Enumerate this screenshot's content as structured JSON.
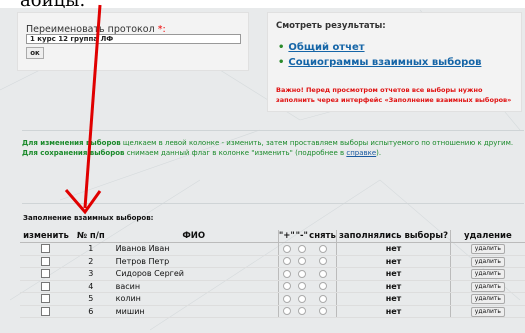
{
  "top_text": "абицы.",
  "rename": {
    "label": "Переименовать протокол",
    "required_mark": " *:",
    "value": "1 курс 12 группа ЛФ",
    "ok_label": "ок"
  },
  "results": {
    "title": "Смотреть результаты:",
    "links": [
      "Общий отчет",
      "Социограммы взаимных выборов"
    ],
    "warning": "Важно! Перед просмотром отчетов все выборы нужно заполнить через интерфейс «Заполнение взаимных выборов»"
  },
  "hint": {
    "line1_bold": "Для изменения выборов",
    "line1_text": " щелкаем в левой колонке - изменить, затем проставляем выборы испытуемого по отношению к другим.",
    "line2_bold": "Для сохранения выборов",
    "line2_text": " снимаем данный флаг в колонке \"изменить\" (подробнее в ",
    "line2_link": "справке",
    "line2_end": ")."
  },
  "section_title": "Заполнение взаимных выборов:",
  "table": {
    "headers": [
      "изменить",
      "№ п/п",
      "ФИО",
      "\"+\"",
      "\"-\"",
      "снять",
      "заполнялись выборы?",
      "удаление"
    ],
    "delete_label": "удалить",
    "rows": [
      {
        "num": "1",
        "name": "Иванов Иван",
        "filled": "нет"
      },
      {
        "num": "2",
        "name": "Петров Петр",
        "filled": "нет"
      },
      {
        "num": "3",
        "name": "Сидоров Сергей",
        "filled": "нет"
      },
      {
        "num": "4",
        "name": "васин",
        "filled": "нет"
      },
      {
        "num": "5",
        "name": "колин",
        "filled": "нет"
      },
      {
        "num": "6",
        "name": "мишин",
        "filled": "нет"
      }
    ]
  },
  "colors": {
    "arrow": "#e00000",
    "link": "#1565a7",
    "hint": "#1a8a2a",
    "warning": "#e01010"
  }
}
